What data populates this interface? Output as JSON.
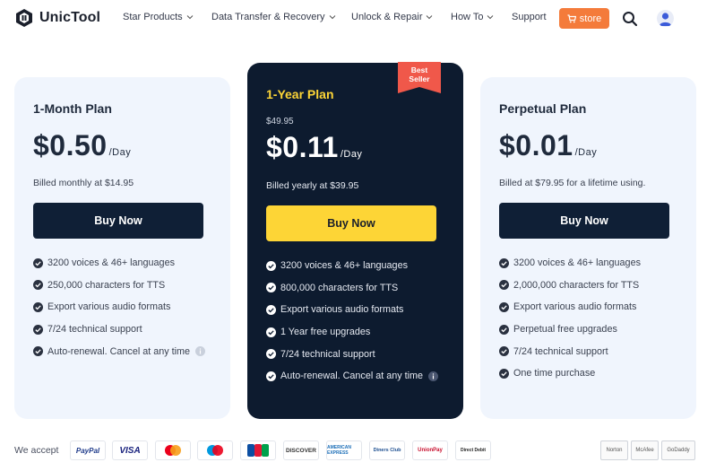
{
  "brand": {
    "name": "UnicTool"
  },
  "nav": {
    "items": [
      {
        "label": "Star Products",
        "has_menu": true
      },
      {
        "label": "Data Transfer & Recovery",
        "has_menu": true
      },
      {
        "label": "Unlock & Repair",
        "has_menu": true
      },
      {
        "label": "How To",
        "has_menu": true
      },
      {
        "label": "Support",
        "has_menu": false
      }
    ],
    "store_label": "store"
  },
  "plans": [
    {
      "name": "1-Month Plan",
      "price": "$0.50",
      "per": "/Day",
      "billed": "Billed monthly at $14.95",
      "buy_label": "Buy Now",
      "features": [
        "3200 voices & 46+ languages",
        "250,000 characters for TTS",
        "Export various audio formats",
        "7/24 technical support",
        "Auto-renewal. Cancel at any time"
      ]
    },
    {
      "name": "1-Year Plan",
      "original_price": "$49.95",
      "price": "$0.11",
      "per": "/Day",
      "billed": "Billed yearly at $39.95",
      "buy_label": "Buy Now",
      "ribbon": [
        "Best",
        "Seller"
      ],
      "features": [
        "3200 voices & 46+ languages",
        "800,000 characters for TTS",
        "Export various audio formats",
        "1 Year free upgrades",
        "7/24 technical support",
        "Auto-renewal. Cancel at any time"
      ]
    },
    {
      "name": "Perpetual Plan",
      "price": "$0.01",
      "per": "/Day",
      "billed": "Billed at $79.95 for a lifetime using.",
      "buy_label": "Buy Now",
      "features": [
        "3200 voices & 46+ languages",
        "2,000,000 characters for TTS",
        "Export various audio formats",
        "Perpetual free upgrades",
        "7/24 technical support",
        "One time purchase"
      ]
    }
  ],
  "footer": {
    "accept_label": "We accept",
    "payments": [
      "PayPal",
      "VISA",
      "Mastercard",
      "Maestro",
      "JCB",
      "DISCOVER",
      "AMERICAN EXPRESS",
      "Diners Club",
      "UnionPay",
      "Direct Debit"
    ],
    "badges": [
      "Norton",
      "McAfee",
      "GoDaddy"
    ]
  },
  "colors": {
    "accent": "#f47b3b",
    "navy": "#0d1b2f",
    "yellow": "#fdd536",
    "card_light": "#f0f5fd",
    "ribbon": "#f0584a"
  }
}
